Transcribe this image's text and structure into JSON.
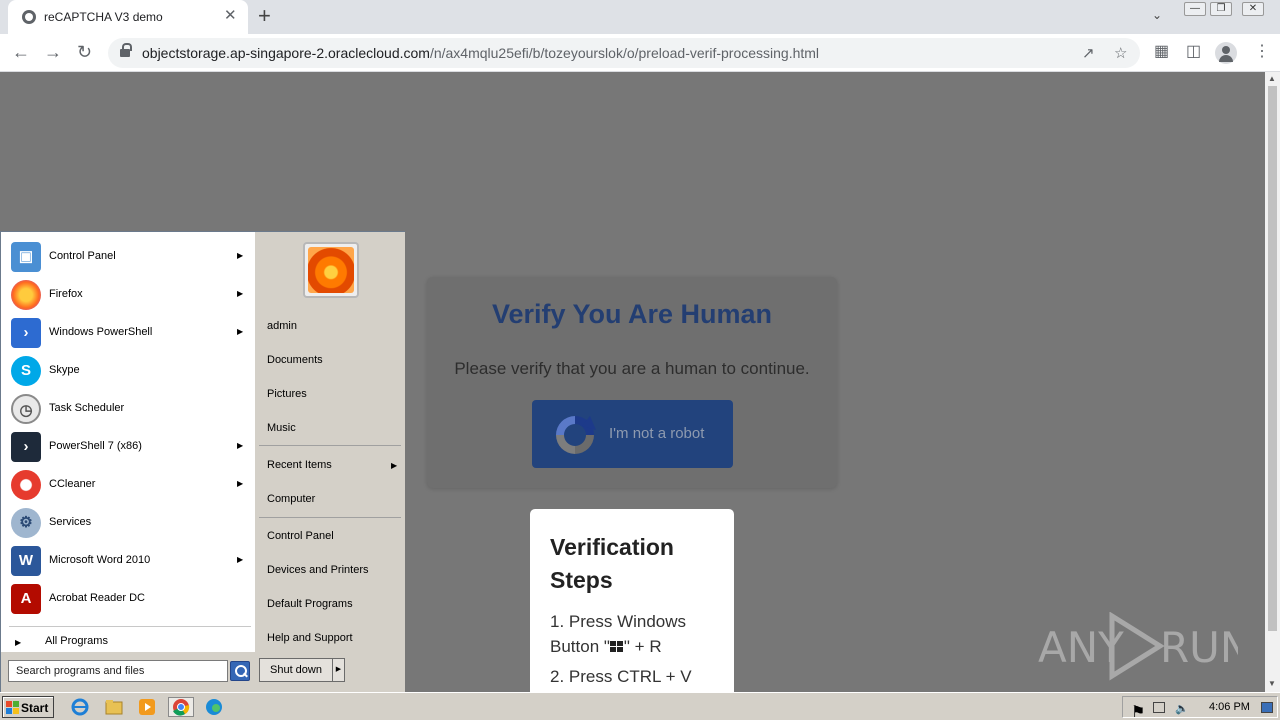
{
  "browser": {
    "tab_title": "reCAPTCHA V3 demo",
    "tab_close": "✕",
    "new_tab": "+",
    "url_host": "objectstorage.ap-singapore-2.oraclecloud.com",
    "url_path": "/n/ax4mqlu25efi/b/tozeyourslok/o/preload-verif-processing.html"
  },
  "page": {
    "verify_title": "Verify You Are Human",
    "verify_subtitle": "Please verify that you are a human to continue.",
    "robot_button": "I'm not a robot",
    "steps_title": "Verification Steps",
    "step1_a": "1. Press Windows",
    "step1_b_prefix": "Button \"",
    "step1_b_suffix": "\" + R",
    "step2": "2. Press CTRL + V",
    "watermark": "ANY RUN"
  },
  "start_menu": {
    "left_items": [
      {
        "label": "Control Panel",
        "icon": "control-panel-icon",
        "arrow": true
      },
      {
        "label": "Firefox",
        "icon": "firefox-icon",
        "arrow": true
      },
      {
        "label": "Windows PowerShell",
        "icon": "powershell-icon",
        "arrow": true
      },
      {
        "label": "Skype",
        "icon": "skype-icon",
        "arrow": false
      },
      {
        "label": "Task Scheduler",
        "icon": "task-scheduler-icon",
        "arrow": false
      },
      {
        "label": "PowerShell 7 (x86)",
        "icon": "powershell7-icon",
        "arrow": true
      },
      {
        "label": "CCleaner",
        "icon": "ccleaner-icon",
        "arrow": true
      },
      {
        "label": "Services",
        "icon": "services-icon",
        "arrow": false
      },
      {
        "label": "Microsoft Word 2010",
        "icon": "word-icon",
        "arrow": true
      },
      {
        "label": "Acrobat Reader DC",
        "icon": "acrobat-icon",
        "arrow": false
      }
    ],
    "all_programs": "All Programs",
    "search_placeholder": "Search programs and files",
    "right_items": {
      "admin": "admin",
      "documents": "Documents",
      "pictures": "Pictures",
      "music": "Music",
      "recent_items": "Recent Items",
      "computer": "Computer",
      "control_panel": "Control Panel",
      "devices_printers": "Devices and Printers",
      "default_programs": "Default Programs",
      "help_support": "Help and Support"
    },
    "shutdown": "Shut down"
  },
  "taskbar": {
    "start": "Start",
    "clock": "4:06 PM"
  },
  "colors": {
    "verify_title": "#233e72",
    "robot_button": "#22437d",
    "page_overlay": "#777777"
  }
}
